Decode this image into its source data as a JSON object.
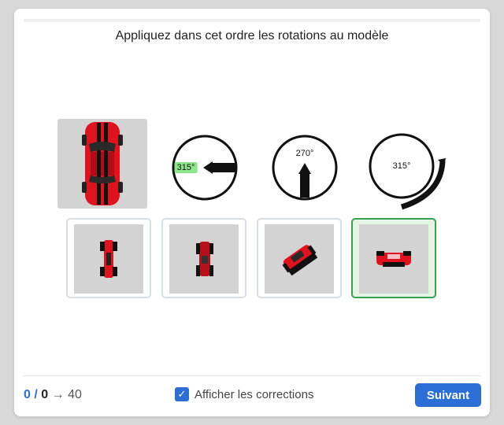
{
  "instruction": "Appliquez dans cet ordre les rotations au modèle",
  "rotations": [
    {
      "angle_label": "315°",
      "highlighted": true,
      "icon": "arrow-left-icon"
    },
    {
      "angle_label": "270°",
      "highlighted": false,
      "icon": "arrow-down-icon"
    },
    {
      "angle_label": "315°",
      "highlighted": false,
      "icon": "arc-arrow-icon"
    }
  ],
  "options": [
    {
      "name": "option-1",
      "selected": false,
      "correct": false
    },
    {
      "name": "option-2",
      "selected": false,
      "correct": false
    },
    {
      "name": "option-3",
      "selected": false,
      "correct": false
    },
    {
      "name": "option-4",
      "selected": false,
      "correct": true
    }
  ],
  "footer": {
    "score_current": "0",
    "score_separator": "/",
    "score_total": "0",
    "score_arrow": "→",
    "score_target": "40",
    "show_corrections_label": "Afficher les corrections",
    "show_corrections_checked": true,
    "next_label": "Suivant"
  },
  "colors": {
    "accent": "#2b6fd6",
    "correct_border": "#3aa055",
    "highlight": "#8ee68a",
    "car_body": "#e0121e",
    "thumb_bg": "#d3d3d3"
  }
}
